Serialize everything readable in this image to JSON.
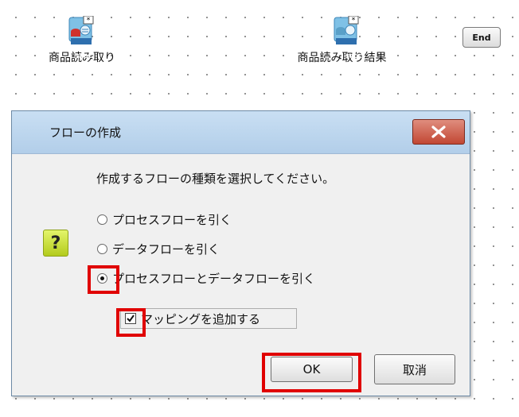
{
  "canvas": {
    "nodes": [
      {
        "label": "商品読み取り",
        "icon": "sfdc-read-icon",
        "badge": "SFDC"
      },
      {
        "label": "商品読み取り結果",
        "icon": "sfdc-result-icon",
        "badge": "SFDC"
      }
    ],
    "end_label": "End"
  },
  "dialog": {
    "title": "フローの作成",
    "prompt": "作成するフローの種類を選択してください。",
    "question_icon": "question-icon",
    "question_mark": "?",
    "options": [
      {
        "label": "プロセスフローを引く",
        "selected": false
      },
      {
        "label": "データフローを引く",
        "selected": false
      },
      {
        "label": "プロセスフローとデータフローを引く",
        "selected": true
      }
    ],
    "checkbox": {
      "label": "マッピングを追加する",
      "checked": true
    },
    "ok_label": "OK",
    "cancel_label": "取消"
  },
  "colors": {
    "highlight": "#e00000",
    "close_button": "#c24733",
    "title_bar": "#b8d2ec"
  }
}
